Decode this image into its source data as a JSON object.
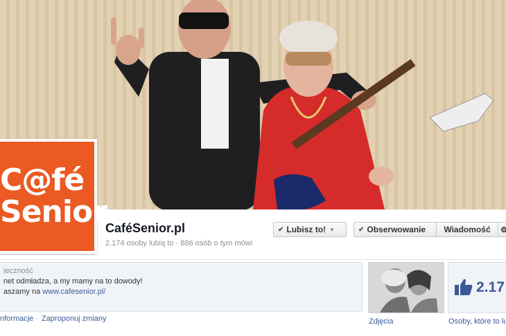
{
  "page": {
    "name": "CaféSenior.pl",
    "stats": "2.174 osoby lubią to · 886 osób o tym mówi",
    "logo_lines": [
      "C@fé",
      "Senior"
    ]
  },
  "buttons": {
    "like_label": "Lubisz to!",
    "follow_label": "Obserwowanie",
    "message_label": "Wiadomość"
  },
  "about": {
    "heading": "ieczność",
    "line1": "net odmładza, a my mamy na to dowody!",
    "line2_prefix": "aszamy na ",
    "link": "www.cafesenior.pl/",
    "info_link": "nformacje",
    "separator": "·",
    "suggest_link": "Zaproponuj zmiany"
  },
  "tiles": {
    "photos_label": "Zdjęcia",
    "likes_count": "2.17",
    "likes_label": "Osoby, które to lu"
  },
  "colors": {
    "brand_orange": "#ea5a22",
    "fb_blue": "#3b5998"
  }
}
